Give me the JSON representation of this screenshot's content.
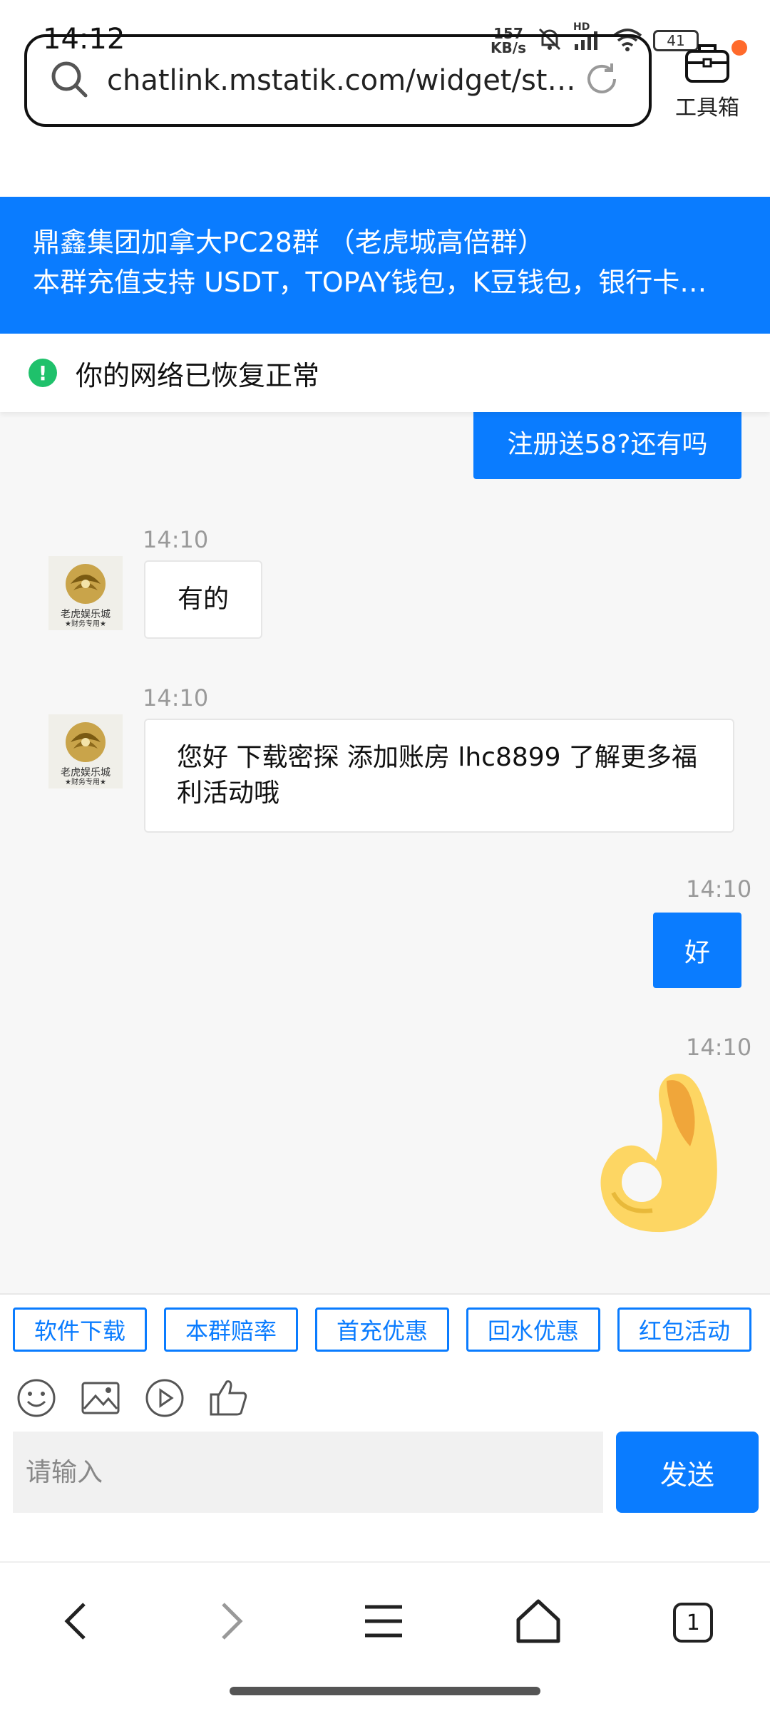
{
  "status_bar": {
    "time": "14:12",
    "net_speed_value": "157",
    "net_speed_unit": "KB/s",
    "hd": "HD",
    "battery": "41"
  },
  "browser": {
    "url": "chatlink.mstatik.com/widget/st…",
    "toolbox_label": "工具箱"
  },
  "group": {
    "title": "鼎鑫集团加拿大PC28群 （老虎城高倍群）",
    "notice": "本群充值支持 USDT，TOPAY钱包，K豆钱包，银行卡…"
  },
  "network": {
    "icon": "!",
    "text": "你的网络已恢复正常"
  },
  "avatar": {
    "name": "老虎娱乐城",
    "sub": "★财务专用★"
  },
  "messages": [
    {
      "side": "right",
      "text": "注册送58?还有吗"
    },
    {
      "side": "left",
      "time": "14:10",
      "text": "有的"
    },
    {
      "side": "left",
      "time": "14:10",
      "text": "您好 下载密探 添加账房 lhc8899 了解更多福利活动哦"
    },
    {
      "side": "right",
      "time": "14:10",
      "text": "好"
    },
    {
      "side": "right",
      "time": "14:10",
      "sticker": "ok-hand-emoji"
    }
  ],
  "quick_buttons": [
    "软件下载",
    "本群赔率",
    "首充优惠",
    "回水优惠",
    "红包活动"
  ],
  "input": {
    "placeholder": "请输入",
    "send_label": "发送"
  },
  "nav": {
    "tabs_count": "1"
  },
  "colors": {
    "accent": "#0a7cff",
    "success": "#1fc16b",
    "notify": "#ff6a2b"
  }
}
